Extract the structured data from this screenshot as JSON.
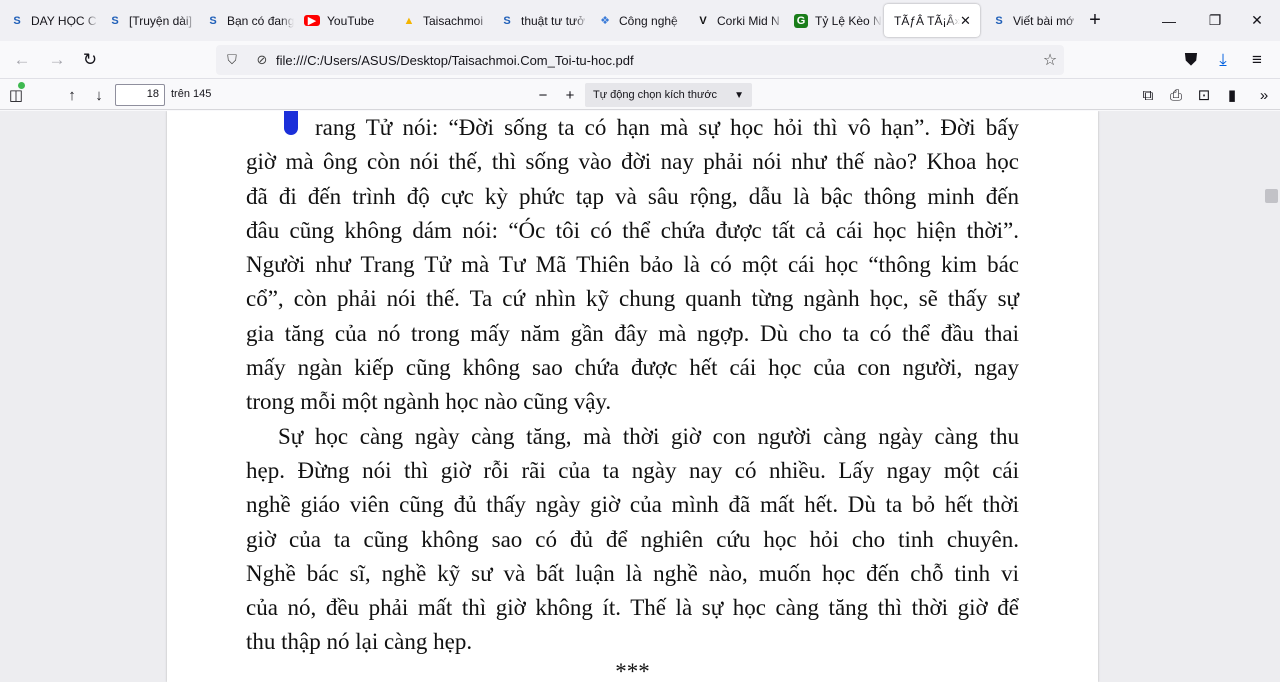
{
  "tabs": [
    {
      "label": "DAY HỌC C",
      "icon": "s-icon"
    },
    {
      "label": "[Truyện dài]",
      "icon": "s-icon"
    },
    {
      "label": "Bạn có đang",
      "icon": "s-icon"
    },
    {
      "label": "YouTube",
      "icon": "youtube-icon"
    },
    {
      "label": "Taisachmoi",
      "icon": "drive-icon"
    },
    {
      "label": "thuật tư tưở",
      "icon": "s-icon"
    },
    {
      "label": "Công nghệ",
      "icon": "w-icon"
    },
    {
      "label": "Corki Mid N",
      "icon": "v-icon"
    },
    {
      "label": "Tỷ Lệ Kèo N",
      "icon": "g-icon"
    },
    {
      "label": "TÃƒÂ­ TÃ¡Â»",
      "icon": "none",
      "active": true
    },
    {
      "label": "Viết bài mớ",
      "icon": "s-icon"
    }
  ],
  "nav": {
    "url": "file:///C:/Users/ASUS/Desktop/Taisachmoi.Com_Toi-tu-hoc.pdf"
  },
  "pdf_toolbar": {
    "page_number": "18",
    "page_total": "trên 145",
    "zoom": "Tự động chọn kích thước"
  },
  "document": {
    "lines": [
      "rang Tử nói: “Đời sống ta có hạn mà sự học hỏi thì vô hạn”. Đời bấy",
      "giờ mà ông còn nói thế, thì sống vào đời nay phải nói như thế nào? Khoa học",
      "đã đi đến trình độ cực kỳ phức tạp và sâu rộng, dẫu là bậc thông minh đến",
      "đâu cũng không dám nói: “Óc tôi có thể chứa được tất cả cái học hiện thời”.",
      "Người như Trang Tử mà Tư Mã Thiên bảo là có một cái học “thông kim bác",
      "cổ”, còn phải nói thế. Ta cứ nhìn kỹ chung quanh từng ngành học, sẽ thấy sự",
      "gia tăng của nó trong mấy năm gần đây mà ngợp. Dù cho ta có thể đầu thai",
      "mấy ngàn kiếp cũng không sao chứa được hết cái học của con người, ngay",
      "trong mỗi một ngành học nào cũng vậy.",
      "Sự học càng ngày càng tăng, mà thời giờ con người càng ngày càng thu",
      "hẹp. Đừng nói thì giờ rỗi rãi của ta ngày nay có nhiều. Lấy ngay một cái",
      "nghề giáo viên cũng đủ thấy ngày giờ của mình đã mất hết. Dù ta bỏ hết thời",
      "giờ của ta cũng không sao có đủ để nghiên cứu học hỏi cho tinh chuyên.",
      "Nghề bác sĩ, nghề kỹ sư và bất luận là nghề nào, muốn học đến chỗ tinh vi",
      "của nó, đều phải mất thì giờ không ít. Thế là sự học càng tăng thì thời giờ để",
      "thu thập nó lại càng hẹp."
    ],
    "separator": "***"
  }
}
